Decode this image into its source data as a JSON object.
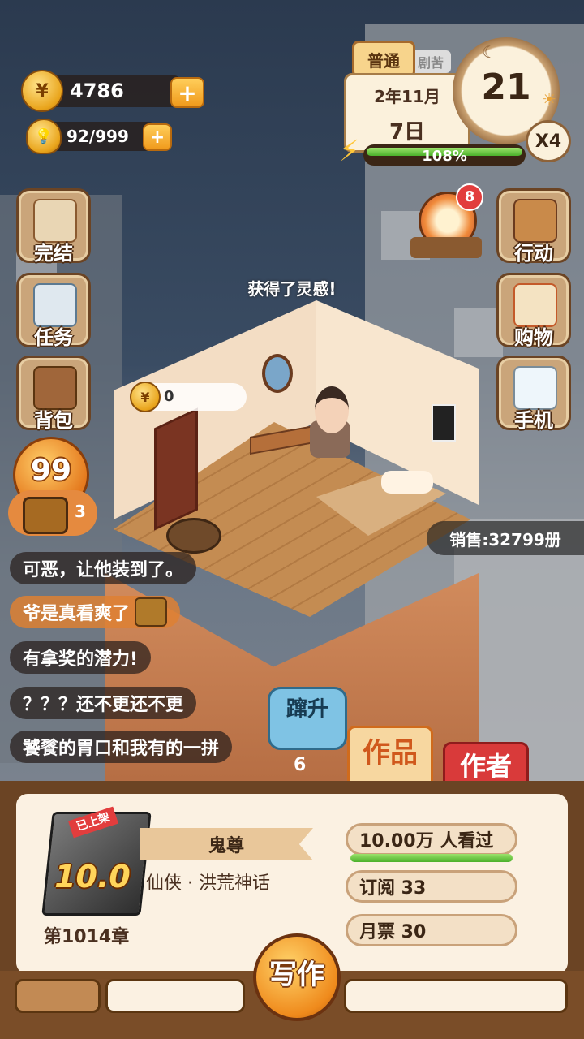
{
  "currency": {
    "coins": "4786",
    "inspiration": "92/999"
  },
  "date": {
    "difficulty": "普通",
    "difficulty_behind": "剧苦",
    "year_month": "2年11月",
    "day": "7日",
    "day_number": "21",
    "speed": "X4",
    "energy_percent": "108%",
    "energy_fraction": 1.0
  },
  "left_menu": [
    {
      "label": "完结",
      "icon": "book-icon"
    },
    {
      "label": "任务",
      "icon": "clipboard-icon"
    },
    {
      "label": "背包",
      "icon": "backpack-icon"
    }
  ],
  "right_menu": [
    {
      "label": "行动",
      "icon": "door-icon"
    },
    {
      "label": "购物",
      "icon": "shop-icon"
    },
    {
      "label": "手机",
      "icon": "phone-icon"
    }
  ],
  "wheel": {
    "badge": "8",
    "icon": "prize-wheel-icon"
  },
  "room": {
    "inspiration_text": "获得了灵感!",
    "coin_bubble_value": "0"
  },
  "promo": {
    "value": "99",
    "chest_count": "3"
  },
  "sales": "销售:32799册",
  "comments": [
    "可恶，让他装到了。",
    "爷是真看爽了",
    "有拿奖的潜力!",
    "？？？还不更还不更",
    "饕餮的胃口和我有的一拼"
  ],
  "boost": {
    "label": "蹿升",
    "count": "6"
  },
  "tabs": {
    "works": "作品",
    "author": "作者"
  },
  "book": {
    "tag": "已上架",
    "score": "10.0",
    "title": "鬼尊",
    "genre": "仙侠 · 洪荒神话",
    "chapter": "第1014章",
    "readers": "10.00万 人看过",
    "subscriptions": "订阅 33",
    "monthly_tickets": "月票 30"
  },
  "write_button": "写作",
  "colors": {
    "accent": "#ef8a1c",
    "panel": "#6b4424",
    "green": "#4bb12b",
    "red": "#d93a3a"
  }
}
